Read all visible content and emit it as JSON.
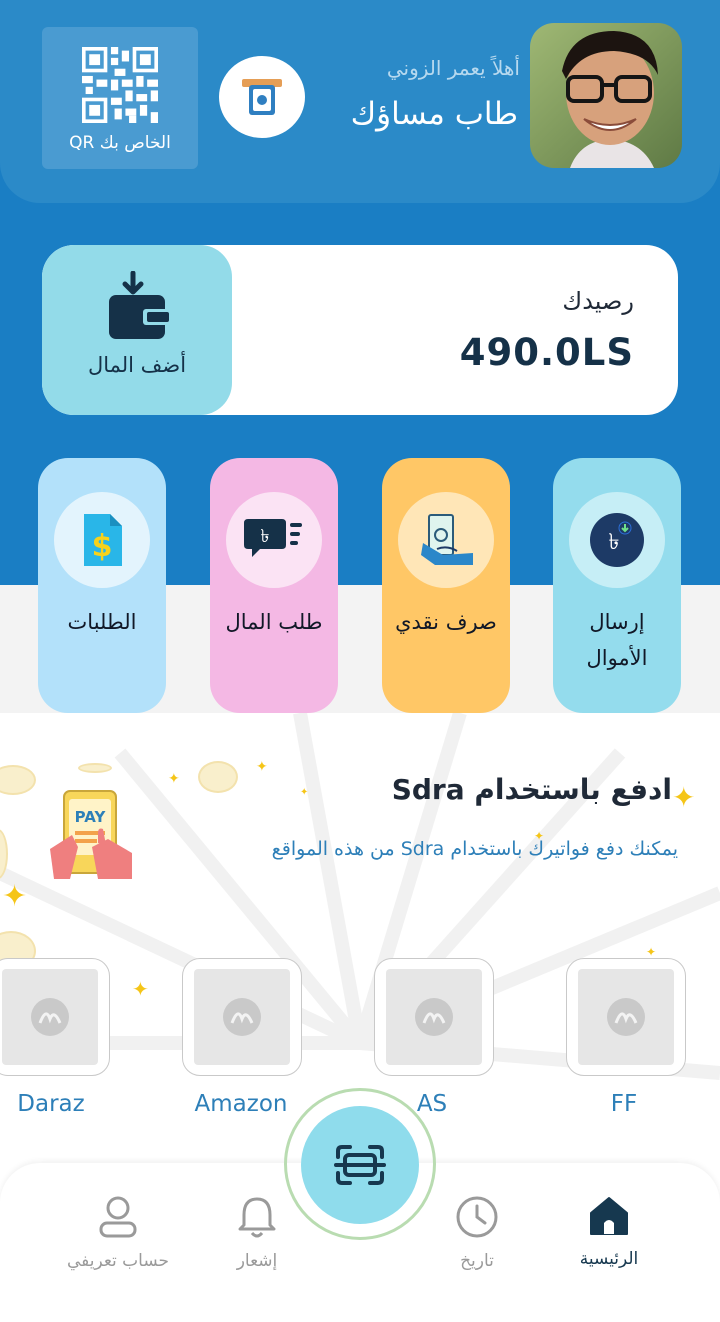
{
  "header": {
    "greeting": "أهلاً يعمر الزوني",
    "user_name": "طاب مساؤك",
    "qr_label": "QR الخاص بك"
  },
  "balance": {
    "label": "رصيدك",
    "value": "490.0LS",
    "add_money_label": "أضف المال"
  },
  "actions": [
    {
      "label": "إرسال الأموال",
      "color": "#94dced"
    },
    {
      "label": "صرف نقدي",
      "color": "#ffc766"
    },
    {
      "label": "طلب المال",
      "color": "#f4b8e4"
    },
    {
      "label": "الطلبات",
      "color": "#b3e1fa"
    }
  ],
  "pay": {
    "title": "ادفع باستخدام Sdra",
    "subtitle": "يمكنك دفع فواتيرك باستخدام Sdra من هذه المواقع",
    "illustration_text": "PAY",
    "merchants": [
      "FF",
      "AS",
      "Amazon",
      "Daraz"
    ]
  },
  "nav": {
    "items": [
      {
        "label": "الرئيسية",
        "icon": "home-icon",
        "active": true
      },
      {
        "label": "تاريخ",
        "icon": "clock-icon",
        "active": false
      },
      {
        "label": "إشعار",
        "icon": "bell-icon",
        "active": false
      },
      {
        "label": "حساب تعريفي",
        "icon": "user-icon",
        "active": false
      }
    ],
    "scan_icon": "scan-icon"
  },
  "colors": {
    "primary": "#1a7ec4",
    "header": "#2b8ac8",
    "dark_navy": "#153148",
    "link_blue": "#2d7fb8"
  }
}
